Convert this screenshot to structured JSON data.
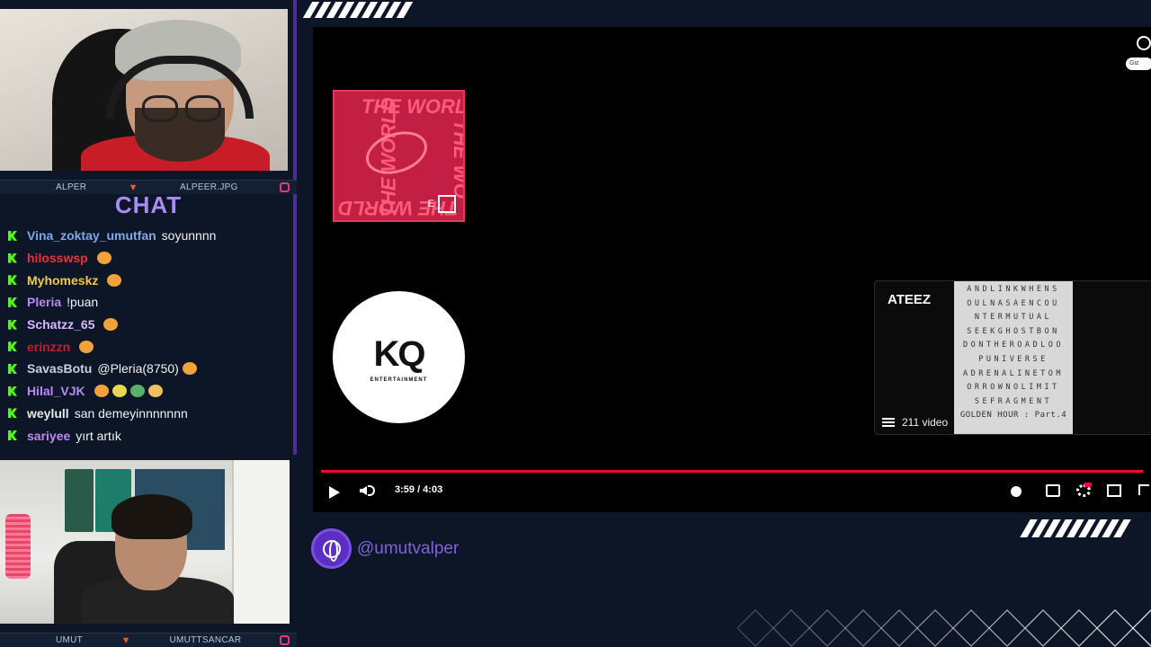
{
  "colors": {
    "accent_purple": "#a98bf6",
    "kick_green": "#53fc18",
    "youtube_red": "#ff0033",
    "instagram_pink": "#e63a7e"
  },
  "cam_top": {
    "left_label": "ALPER",
    "right_label": "ALPEER.JPG"
  },
  "cam_bottom": {
    "left_label": "UMUT",
    "right_label": "UMUTTSANCAR"
  },
  "chat": {
    "title": "CHAT",
    "messages": [
      {
        "user": "Vina_zoktay_umutfan",
        "color": "#7fa8e8",
        "text": "soyunnnn",
        "emotes": 0
      },
      {
        "user": "hilosswsp",
        "color": "#e8323a",
        "text": "",
        "emotes": 1
      },
      {
        "user": "Myhomeskz",
        "color": "#f2c94c",
        "text": "",
        "emotes": 1
      },
      {
        "user": "Pleria",
        "color": "#b88af2",
        "text": "!puan",
        "emotes": 0
      },
      {
        "user": "Schatzz_65",
        "color": "#d9b8ff",
        "text": "",
        "emotes": 1
      },
      {
        "user": "erinzzn",
        "color": "#c81c26",
        "text": "",
        "emotes": 1
      },
      {
        "user": "SavasBotu",
        "color": "#c8d0dc",
        "text": "@Pleria(8750)",
        "emotes": 1
      },
      {
        "user": "Hilal_VJK",
        "color": "#b68af7",
        "text": "",
        "emotes": 4
      },
      {
        "user": "weylull",
        "color": "#e8e8e8",
        "text": "san demeyinnnnnnn",
        "emotes": 0
      },
      {
        "user": "sariyee",
        "color": "#c08af5",
        "text": "yırt artık",
        "emotes": 0
      }
    ]
  },
  "album": {
    "title_text": "THE WORLD"
  },
  "label_logo": {
    "mark": "KQ",
    "sub": "ENTERTAINMENT"
  },
  "top_right": {
    "pill": "Giz"
  },
  "playlist": {
    "channel": "ATEEZ",
    "count": "211 video",
    "puzzle_rows": [
      "ANDLINKWHENS",
      "OULNASAENCOU",
      "NTERMUTUAL",
      "SEEKGHOSTBON",
      "DONTHEROADLOO",
      "PUNIVERSE",
      "ADRENALINETOM",
      "ORROWNOLIMIT",
      "SEFRAGMENT",
      "GOLDEN HOUR : Part.4"
    ]
  },
  "player": {
    "time": "3:59 / 4:03",
    "progress": 0.99,
    "quality_badge": "HD"
  },
  "brand": {
    "handle": "@umutvalper",
    "icon": "globe-icon"
  }
}
